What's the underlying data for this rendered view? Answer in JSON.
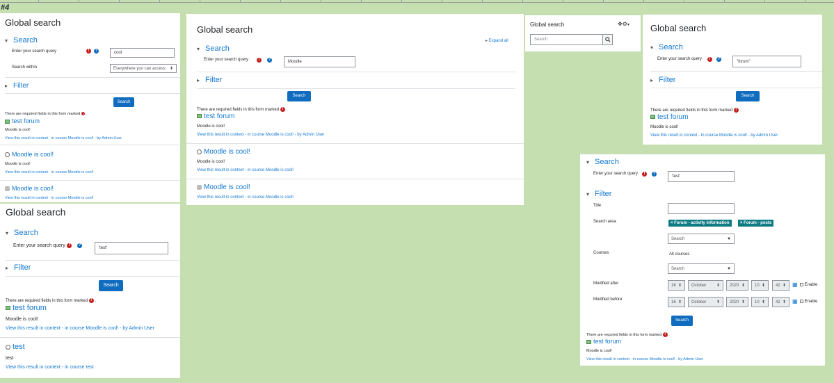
{
  "image_tag": "#4",
  "colors": {
    "background": "#c5dfb0",
    "primary": "#0f6cbf",
    "link": "#1177d1",
    "required": "#c41f1f",
    "chip": "#0f7c84"
  },
  "p1": {
    "title": "Global search",
    "search_section": "Search",
    "query_label": "Enter your search query",
    "query_value": "cool",
    "within_label": "Search within",
    "within_value": "Everywhere you can access",
    "filter_section": "Filter",
    "search_button": "Search",
    "required_note": "There are required fields in this form marked",
    "results": [
      {
        "title": "test forum",
        "text": "Moodle is cool!",
        "context": "View this result in context - in course Moodle is cool! - by Admin User"
      },
      {
        "title": "Moodle is cool!",
        "text": "Moodle is cool!",
        "context": "View this result in context - in course Moodle is cool!"
      },
      {
        "title": "Moodle is cool!",
        "context": "View this result in context - in course Moodle is cool!"
      }
    ]
  },
  "p2": {
    "title": "Global search",
    "expand_all": "Expand all",
    "search_section": "Search",
    "query_label": "Enter your search query",
    "query_value": "Moodle",
    "filter_section": "Filter",
    "search_button": "Search",
    "required_note": "There are required fields in this form marked",
    "results": [
      {
        "title": "test forum",
        "text": "Moodle is cool!",
        "context": "View this result in context - in course Moodle is cool! - by Admin User"
      },
      {
        "title": "Moodle is cool!",
        "text": "Moodle is cool!",
        "context": "View this result in context - in course Moodle is cool!"
      },
      {
        "title": "Moodle is cool!",
        "context": "View this result in context - in course Moodle is cool!"
      }
    ]
  },
  "p3": {
    "title": "Global search",
    "placeholder": "Search"
  },
  "p4": {
    "title": "Global search",
    "search_section": "Search",
    "query_label": "Enter your search query",
    "query_value": "\"forum\"",
    "filter_section": "Filter",
    "search_button": "Search",
    "required_note": "There are required fields in this form marked",
    "results": [
      {
        "title": "test forum",
        "text": "Moodle is cool!",
        "context": "View this result in context - in course Moodle is cool! - by Admin User"
      }
    ]
  },
  "p5": {
    "title": "Global search",
    "search_section": "Search",
    "query_label": "Enter your search query",
    "query_value": "'test'",
    "filter_section": "Filter",
    "search_button": "Search",
    "required_note": "There are required fields in this form marked",
    "results": [
      {
        "title": "test forum",
        "text": "Moodle is cool!",
        "context": "View this result in context - in course Moodle is cool! - by Admin User"
      },
      {
        "title": "test",
        "text": "test",
        "context": "View this result in context - in course test"
      }
    ]
  },
  "p6": {
    "search_section": "Search",
    "query_label": "Enter your search query",
    "query_value": "'test'",
    "filter_section": "Filter",
    "title_label": "Title",
    "area_label": "Search area",
    "chips": [
      "× Forum - activity information",
      "× Forum - posts"
    ],
    "area_dropdown": "Search",
    "courses_label": "Courses",
    "courses_value": "All courses",
    "courses_dropdown": "Search",
    "after_label": "Modified after",
    "before_label": "Modified before",
    "date": {
      "day": "16",
      "month": "October",
      "year": "2020",
      "hour": "10",
      "minute": "42"
    },
    "enable_label": "Enable",
    "search_button": "Search",
    "required_note": "There are required fields in this form marked",
    "results": [
      {
        "title": "test forum",
        "text": "Moodle is cool!",
        "context": "View this result in context - in course Moodle is cool! - by Admin User"
      }
    ]
  }
}
